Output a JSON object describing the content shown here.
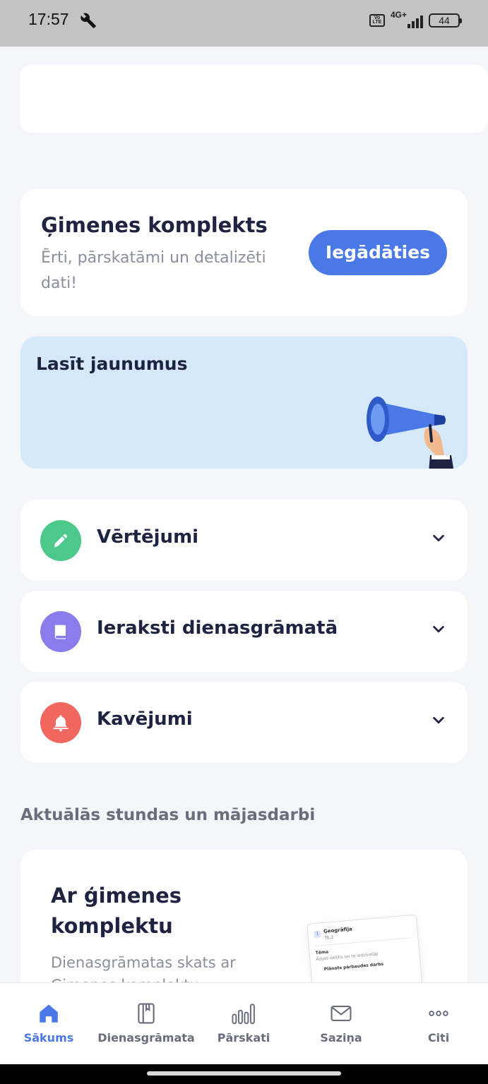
{
  "status_bar": {
    "time": "17:57",
    "network": "4G+",
    "volte": "Vo LTE",
    "battery": "44"
  },
  "promo": {
    "title": "Ģimenes komplekts",
    "subtitle": "Ērti, pārskatāmi un detalizēti dati!",
    "button": "Iegādāties",
    "accent_color": "#4a78e6"
  },
  "news": {
    "title": "Lasīt jaunumus"
  },
  "sections": [
    {
      "label": "Vērtējumi",
      "icon": "pencil-icon",
      "color": "#4cc98a"
    },
    {
      "label": "Ieraksti dienasgrāmatā",
      "icon": "book-icon",
      "color": "#8a7cea"
    },
    {
      "label": "Kavējumi",
      "icon": "bell-icon",
      "color": "#f1665e"
    }
  ],
  "lessons": {
    "heading": "Aktuālās stundas un mājasdarbi",
    "card_title": "Ar ģimenes komplektu",
    "card_subtitle": "Dienasgrāmatas skats ar Ģimenes komplektu",
    "preview": {
      "number": "1",
      "subject": "Ģeogrāfija",
      "grade": "7b.2",
      "topic_label": "Tēma",
      "topic": "Āzijas valstis un to iedzīvotāji",
      "check": "Plānots pārbaudes darbs"
    }
  },
  "bottom_nav": [
    {
      "label": "Sākums",
      "icon": "home-icon",
      "active": true
    },
    {
      "label": "Dienasgrāmata",
      "icon": "diary-icon",
      "active": false
    },
    {
      "label": "Pārskati",
      "icon": "bar-chart-icon",
      "active": false
    },
    {
      "label": "Saziņa",
      "icon": "mail-icon",
      "active": false
    },
    {
      "label": "Citi",
      "icon": "more-icon",
      "active": false
    }
  ]
}
